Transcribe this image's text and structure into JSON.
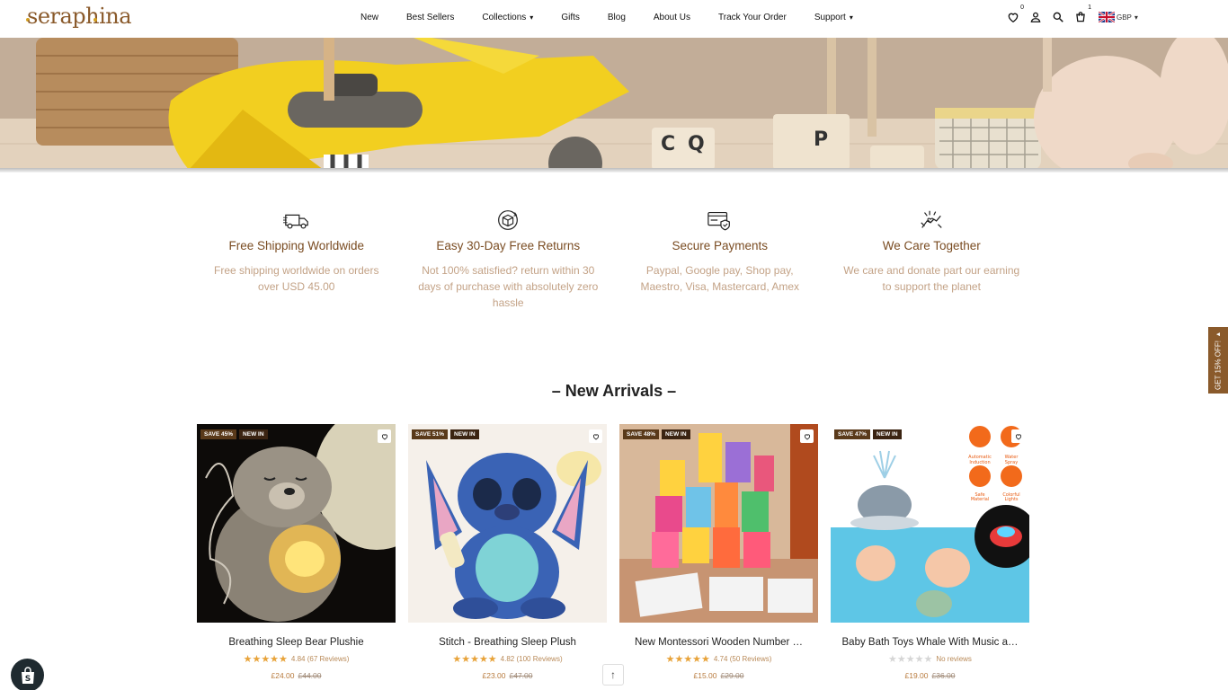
{
  "brand": {
    "logo_text": "seraphina"
  },
  "nav": {
    "items": [
      {
        "label": "New",
        "dropdown": false
      },
      {
        "label": "Best Sellers",
        "dropdown": false
      },
      {
        "label": "Collections",
        "dropdown": true
      },
      {
        "label": "Gifts",
        "dropdown": false
      },
      {
        "label": "Blog",
        "dropdown": false
      },
      {
        "label": "About Us",
        "dropdown": false
      },
      {
        "label": "Track Your Order",
        "dropdown": false
      },
      {
        "label": "Support",
        "dropdown": true
      }
    ]
  },
  "header_icons": {
    "wishlist_count": "0",
    "cart_count": "1",
    "currency": "GBP",
    "icons": [
      "heart-icon",
      "account-icon",
      "search-icon",
      "cart-icon",
      "uk-flag-icon"
    ]
  },
  "features": [
    {
      "icon": "truck-icon",
      "title": "Free Shipping Worldwide",
      "text": "Free shipping worldwide on orders over USD 45.00"
    },
    {
      "icon": "return-box-icon",
      "title": "Easy 30-Day Free Returns",
      "text": "Not 100% satisfied? return within 30 days of purchase with absolutely zero hassle"
    },
    {
      "icon": "secure-card-icon",
      "title": "Secure Payments",
      "text": "Paypal, Google pay, Shop pay, Maestro, Visa, Mastercard, Amex"
    },
    {
      "icon": "care-hands-icon",
      "title": "We Care Together",
      "text": "We care and donate part our earning to support the planet"
    }
  ],
  "new_arrivals": {
    "title": "– New Arrivals –",
    "products": [
      {
        "save_tag": "SAVE 45%",
        "new_tag": "NEW IN",
        "name": "Breathing Sleep Bear Plushie",
        "rating": "4.84",
        "reviews": "(67 Reviews)",
        "rating_value": 4.84,
        "price": "£24.00",
        "old_price": "£44.00"
      },
      {
        "save_tag": "SAVE 51%",
        "new_tag": "NEW IN",
        "name": "Stitch - Breathing Sleep Plush",
        "rating": "4.82",
        "reviews": "(100 Reviews)",
        "rating_value": 4.82,
        "price": "£23.00",
        "old_price": "£47.00"
      },
      {
        "save_tag": "SAVE 48%",
        "new_tag": "NEW IN",
        "name": "New Montessori Wooden Number …",
        "rating": "4.74",
        "reviews": "(50 Reviews)",
        "rating_value": 4.74,
        "price": "£15.00",
        "old_price": "£29.00"
      },
      {
        "save_tag": "SAVE 47%",
        "new_tag": "NEW IN",
        "name": "Baby Bath Toys Whale With Music a…",
        "rating": "",
        "reviews": "No reviews",
        "rating_value": 0,
        "price": "£19.00",
        "old_price": "£36.00"
      }
    ],
    "whale_badges": [
      "Automatic Induction",
      "Water Spray",
      "Safe Material",
      "Colorful Lights"
    ]
  },
  "side_tab": {
    "label": "GET 15% OFF! ▸"
  },
  "colors": {
    "brand": "#8a5a2b",
    "feature_title": "#7a4c22",
    "feature_text": "#c3a286",
    "star": "#e8a33a",
    "tag_bg": "#5a3a1a"
  }
}
